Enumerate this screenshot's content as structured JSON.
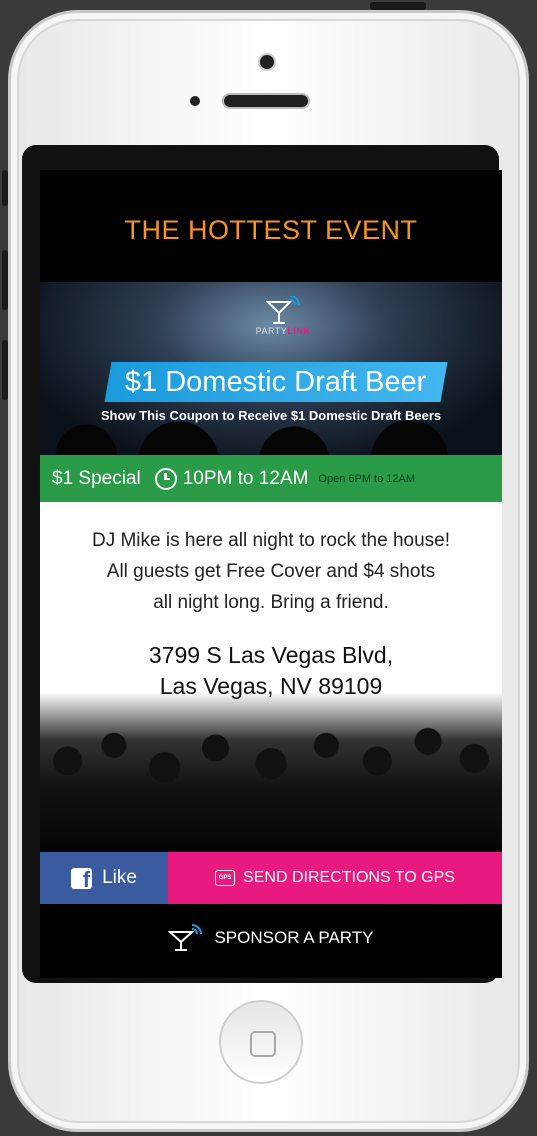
{
  "header": {
    "title": "THE HOTTEST EVENT"
  },
  "banner": {
    "logo_icon": "martini-wifi-icon",
    "logo_party": "PARTY",
    "logo_link": "LINK",
    "headline": "$1 Domestic Draft Beer",
    "subline": "Show This Coupon to Receive $1 Domestic Draft Beers"
  },
  "special": {
    "label": "$1 Special",
    "clock_icon": "clock-icon",
    "time": "10PM to 12AM",
    "open_hours": "Open 6PM to 12AM"
  },
  "description": {
    "line1": "DJ Mike is here all night to rock the house!",
    "line2": "All guests get Free Cover and $4 shots",
    "line3": "all night long. Bring a friend."
  },
  "address": {
    "line1": "3799 S Las Vegas Blvd,",
    "line2": "Las Vegas, NV 89109"
  },
  "actions": {
    "like_label": "Like",
    "like_icon": "facebook-icon",
    "gps_icon_text": "GPS",
    "gps_label": "SEND DIRECTIONS TO GPS"
  },
  "sponsor": {
    "icon": "martini-wifi-icon",
    "label": "SPONSOR A PARTY"
  },
  "colors": {
    "title_orange": "#f7941d",
    "special_green": "#2a9b47",
    "facebook_blue": "#3b5ba0",
    "gps_pink": "#e8197f",
    "ribbon_blue": "#1a9bdc"
  }
}
